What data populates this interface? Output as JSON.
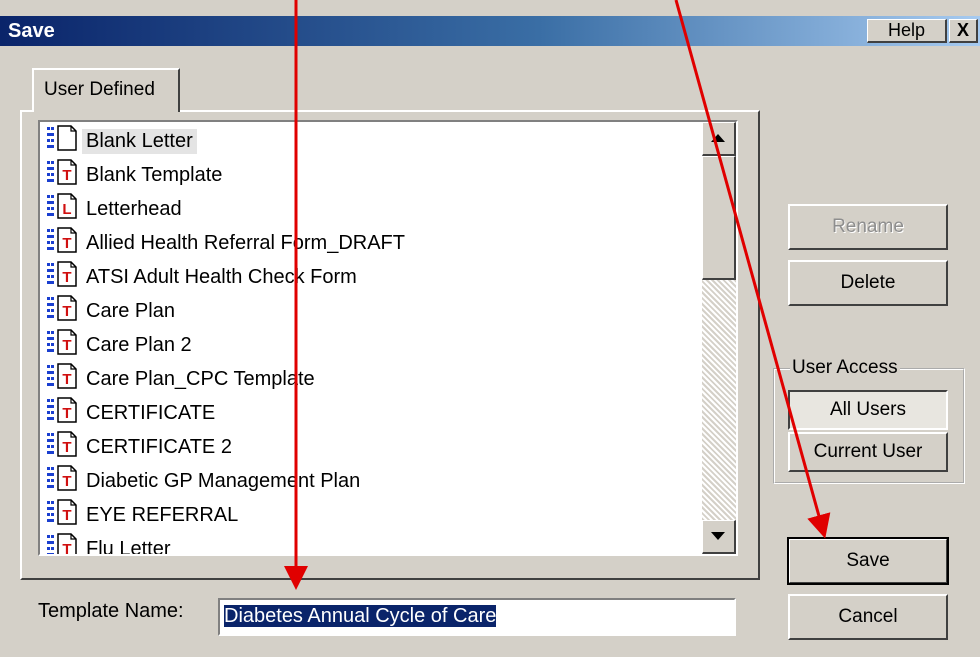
{
  "window": {
    "title": "Save",
    "help_label": "Help",
    "close_label": "X"
  },
  "tabs": [
    {
      "label": "User Defined"
    }
  ],
  "template_list": {
    "items": [
      {
        "label": "Blank Letter",
        "icon": "blank-letter-icon",
        "selected": true
      },
      {
        "label": "Blank Template",
        "icon": "template-icon"
      },
      {
        "label": "Letterhead",
        "icon": "letterhead-icon"
      },
      {
        "label": "Allied Health Referral Form_DRAFT",
        "icon": "template-icon"
      },
      {
        "label": "ATSI Adult Health Check Form",
        "icon": "template-icon"
      },
      {
        "label": "Care Plan",
        "icon": "template-icon"
      },
      {
        "label": "Care Plan 2",
        "icon": "template-icon"
      },
      {
        "label": "Care Plan_CPC Template",
        "icon": "template-icon"
      },
      {
        "label": "CERTIFICATE",
        "icon": "template-icon"
      },
      {
        "label": "CERTIFICATE 2",
        "icon": "template-icon"
      },
      {
        "label": "Diabetic GP Management Plan",
        "icon": "template-icon"
      },
      {
        "label": "EYE REFERRAL",
        "icon": "template-icon"
      },
      {
        "label": "Flu Letter",
        "icon": "template-icon"
      }
    ]
  },
  "buttons": {
    "rename": "Rename",
    "delete": "Delete",
    "save": "Save",
    "cancel": "Cancel"
  },
  "user_access": {
    "label": "User Access",
    "options": [
      "All Users",
      "Current User"
    ],
    "selected": "All Users"
  },
  "template_name": {
    "label": "Template Name:",
    "value": "Diabetes Annual Cycle of Care"
  },
  "colors": {
    "title_bar": "#0a246a",
    "annotation_arrow": "#e00000",
    "dialog_face": "#d4d0c8"
  }
}
